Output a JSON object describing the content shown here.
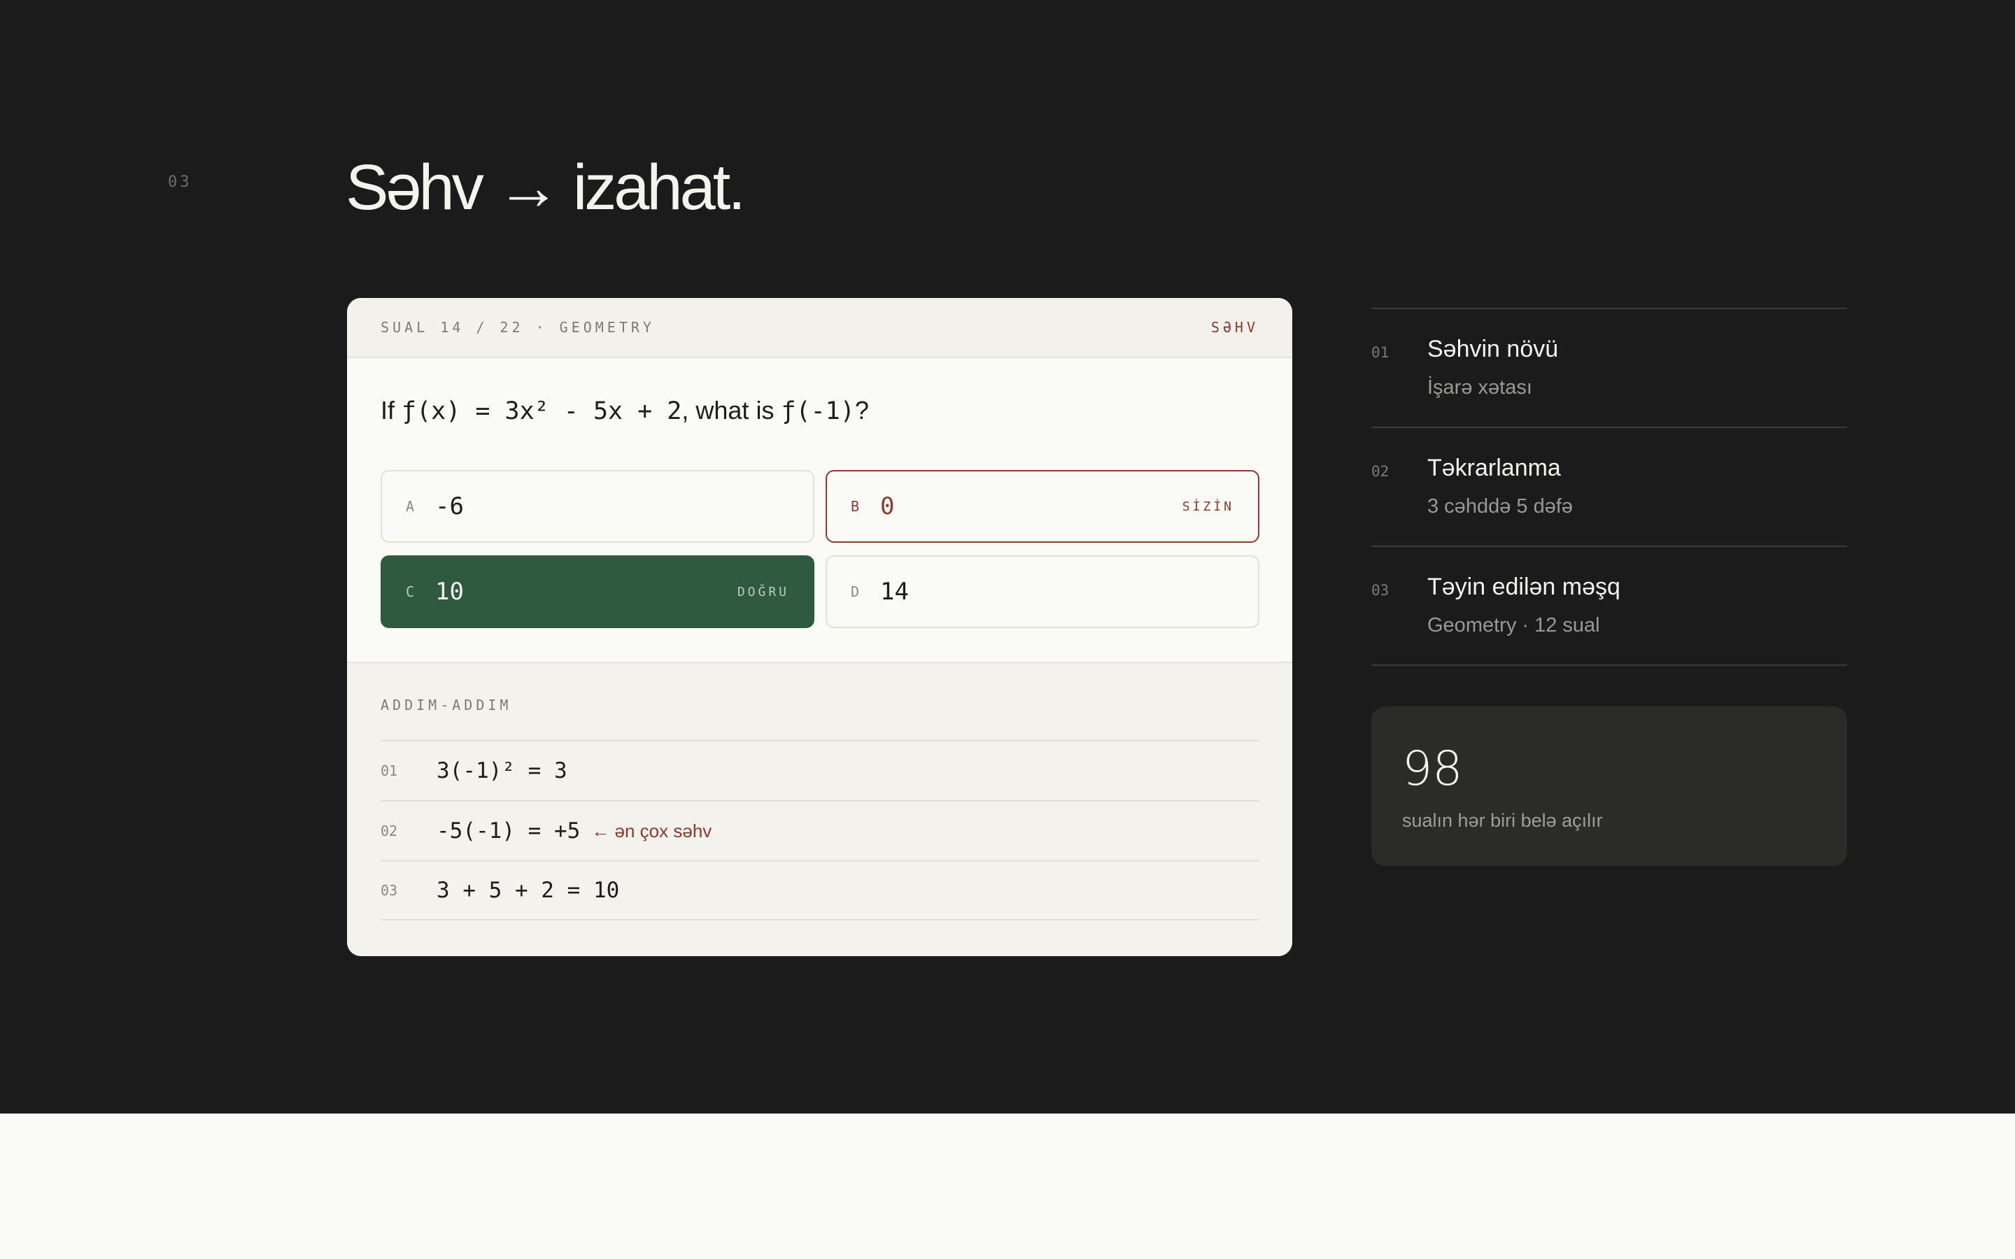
{
  "section": {
    "number": "03",
    "headline": "Səhv → izahat."
  },
  "card": {
    "header_meta": "SUAL 14 / 22 · GEOMETRY",
    "status": "SƏHV",
    "question": {
      "prefix": "If ",
      "function_def": "ƒ(x) = 3x² - 5x + 2",
      "middle": ", what is ",
      "target": "ƒ(-1)",
      "suffix": "?"
    },
    "options": [
      {
        "letter": "A",
        "value": "-6",
        "tag": ""
      },
      {
        "letter": "B",
        "value": "0",
        "tag": "SİZİN"
      },
      {
        "letter": "C",
        "value": "10",
        "tag": "DOĞRU"
      },
      {
        "letter": "D",
        "value": "14",
        "tag": ""
      }
    ],
    "steps_title": "ADDIM-ADDIM",
    "steps": [
      {
        "num": "01",
        "expr": "3(-1)² = 3",
        "note": ""
      },
      {
        "num": "02",
        "expr": "-5(-1) = +5",
        "note": "← ən çox səhv"
      },
      {
        "num": "03",
        "expr": "3 + 5 + 2 = 10",
        "note": ""
      }
    ]
  },
  "side": {
    "items": [
      {
        "num": "01",
        "title": "Səhvin növü",
        "sub": "İşarə xətası"
      },
      {
        "num": "02",
        "title": "Təkrarlanma",
        "sub": "3 cəhddə 5 dəfə"
      },
      {
        "num": "03",
        "title": "Təyin edilən məşq",
        "sub": "Geometry · 12 sual"
      }
    ]
  },
  "stat": {
    "value": "98",
    "label": "sualın hər biri belə açılır"
  },
  "colors": {
    "background_dark": "#1b1b1b",
    "card_bg": "#fafaf6",
    "wrong": "#8a3a2e",
    "correct": "#2f5a3f"
  }
}
